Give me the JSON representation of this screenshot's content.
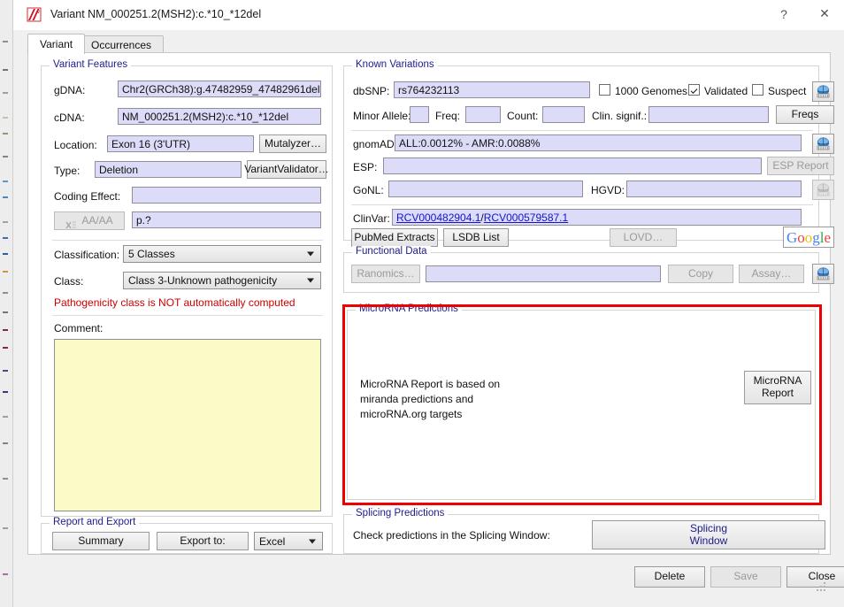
{
  "window": {
    "title": "Variant NM_000251.2(MSH2):c.*10_*12del",
    "logo_icon": "alamut-logo-icon",
    "help_label": "?",
    "close_label": "✕"
  },
  "tabs": [
    {
      "label": "Variant",
      "active": true
    },
    {
      "label": "Occurrences",
      "active": false
    }
  ],
  "variant_features": {
    "legend": "Variant Features",
    "gdna_label": "gDNA:",
    "gdna_value": "Chr2(GRCh38):g.47482959_47482961del",
    "cdna_label": "cDNA:",
    "cdna_value": "NM_000251.2(MSH2):c.*10_*12del",
    "location_label": "Location:",
    "location_value": "Exon 16 (3'UTR)",
    "mutalyzer_label": "Mutalyzer…",
    "type_label": "Type:",
    "type_value": "Deletion",
    "variantvalidator_label": "VariantValidator…",
    "coding_effect_label": "Coding Effect:",
    "coding_effect_value": "",
    "aa_button_label": "AA/AA",
    "aa_button_icon": "protein-aa-icon",
    "protein_value": "p.?",
    "classification_label": "Classification:",
    "classification_value": "5 Classes",
    "class_label": "Class:",
    "class_value": "Class 3-Unknown pathogenicity",
    "warning_text": "Pathogenicity class is NOT automatically computed",
    "warning_color": "#d00000",
    "comment_label": "Comment:",
    "comment_value": "",
    "comment_bg": "#fbfbc8"
  },
  "report_export": {
    "legend": "Report and Export",
    "summary_label": "Summary",
    "export_to_label": "Export to:",
    "format_value": "Excel"
  },
  "known_variations": {
    "legend": "Known Variations",
    "dbsnp_label": "dbSNP:",
    "dbsnp_value": "rs764232113",
    "checkbox_1000g_label": "1000 Genomes",
    "checkbox_1000g_checked": false,
    "checkbox_validated_label": "Validated",
    "checkbox_validated_checked": true,
    "checkbox_suspect_label": "Suspect",
    "checkbox_suspect_checked": false,
    "dbsnp_globe_icon": "ncbi-globe-icon",
    "minor_allele_label": "Minor Allele:",
    "minor_allele_value": "",
    "freq_label": "Freq:",
    "freq_value": "",
    "count_label": "Count:",
    "count_value": "",
    "clin_signif_label": "Clin. signif.:",
    "clin_signif_value": "",
    "freqs_button_label": "Freqs",
    "gnomad_label": "gnomAD:",
    "gnomad_value": "ALL:0.0012% - AMR:0.0088%",
    "gnomad_globe_icon": "ncbi-globe-icon",
    "esp_label": "ESP:",
    "esp_value": "",
    "esp_report_label": "ESP Report",
    "gonl_label": "GoNL:",
    "gonl_value": "",
    "hgvd_label": "HGVD:",
    "hgvd_value": "",
    "hgvd_globe_icon": "ncbi-globe-icon",
    "clinvar_label": "ClinVar:",
    "clinvar_links": [
      "RCV000482904.1",
      "RCV000579587.1"
    ],
    "clinvar_separator": " / ",
    "pubmed_label": "PubMed Extracts",
    "lsdb_label": "LSDB List",
    "lovd_label": "LOVD…",
    "google_label": "Google",
    "google_letters": [
      {
        "ch": "G",
        "color": "#4285f4"
      },
      {
        "ch": "o",
        "color": "#ea4335"
      },
      {
        "ch": "o",
        "color": "#fbbc05"
      },
      {
        "ch": "g",
        "color": "#4285f4"
      },
      {
        "ch": "l",
        "color": "#34a853"
      },
      {
        "ch": "e",
        "color": "#ea4335"
      }
    ]
  },
  "functional_data": {
    "legend": "Functional Data",
    "ranomics_label": "Ranomics…",
    "value": "",
    "copy_label": "Copy",
    "assay_label": "Assay…",
    "globe_icon": "ncbi-globe-icon"
  },
  "microrna": {
    "legend": "MicroRNA Predictions",
    "description": "MicroRNA Report is based on\nmiranda predictions and\nmicroRNA.org targets",
    "report_button_label": "MicroRNA\nReport",
    "highlight_color": "#ee0000"
  },
  "splicing": {
    "legend": "Splicing Predictions",
    "prompt": "Check predictions in the Splicing Window:",
    "button_label": "Splicing\nWindow"
  },
  "footer": {
    "delete_label": "Delete",
    "save_label": "Save",
    "save_disabled": true,
    "close_label": "Close"
  },
  "bleed_pixels": [
    {
      "t": 46,
      "c": "#8a8f9b"
    },
    {
      "t": 78,
      "c": "#6e7480"
    },
    {
      "t": 104,
      "c": "#9aa0aa"
    },
    {
      "t": 132,
      "c": "#c0c4a8"
    },
    {
      "t": 150,
      "c": "#8d9a6e"
    },
    {
      "t": 176,
      "c": "#7d8390"
    },
    {
      "t": 204,
      "c": "#5f95c8"
    },
    {
      "t": 222,
      "c": "#4a88c0"
    },
    {
      "t": 250,
      "c": "#9aa4b0"
    },
    {
      "t": 268,
      "c": "#3f6fae"
    },
    {
      "t": 286,
      "c": "#2f5fa0"
    },
    {
      "t": 306,
      "c": "#c89a3a"
    },
    {
      "t": 330,
      "c": "#8a8f9b"
    },
    {
      "t": 352,
      "c": "#6e7480"
    },
    {
      "t": 372,
      "c": "#7a3038"
    },
    {
      "t": 392,
      "c": "#8a2a34"
    },
    {
      "t": 418,
      "c": "#4a4a86"
    },
    {
      "t": 442,
      "c": "#3c3c78"
    },
    {
      "t": 470,
      "c": "#9aa0aa"
    },
    {
      "t": 500,
      "c": "#7d8390"
    },
    {
      "t": 540,
      "c": "#8a8f9b"
    },
    {
      "t": 596,
      "c": "#9aa0aa"
    },
    {
      "t": 648,
      "c": "#b06aa0"
    }
  ]
}
